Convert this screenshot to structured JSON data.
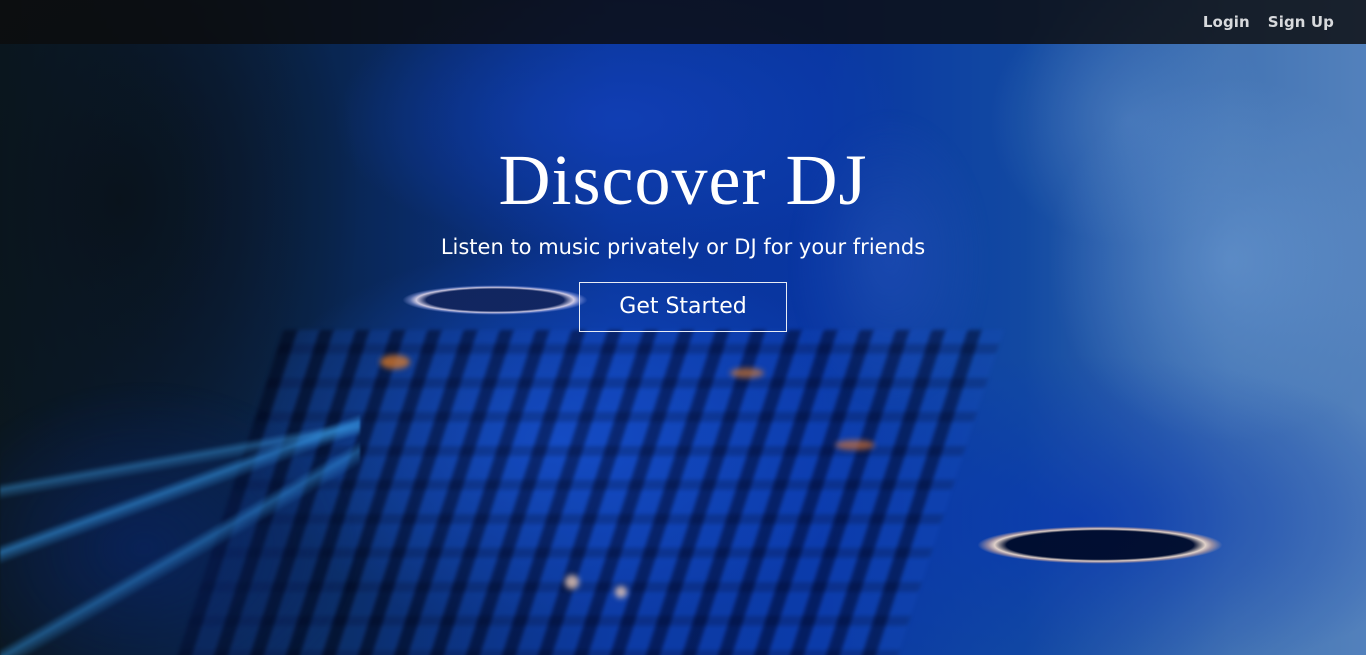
{
  "navbar": {
    "links": [
      {
        "label": "Login"
      },
      {
        "label": "Sign Up"
      }
    ]
  },
  "hero": {
    "title": "Discover DJ",
    "subtitle": "Listen to music privately or DJ for your friends",
    "cta_label": "Get Started"
  },
  "background": {
    "description_icon": "dj-mixer-photo",
    "accent": "#0b3aa8"
  }
}
